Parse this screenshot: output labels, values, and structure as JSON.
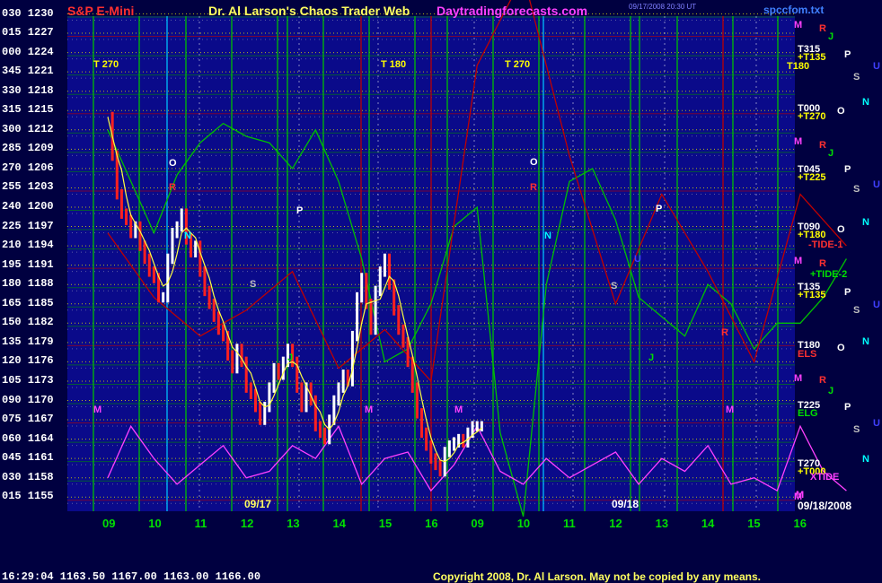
{
  "header": {
    "left_title": "S&P E-Mini",
    "center_title": "Dr. Al Larson's Chaos Trader Web",
    "site": "Daytradingforecasts.com",
    "timestamp": "09/17/2008 20:30 UT",
    "file": "spccfom.txt"
  },
  "footer": {
    "quote": "16:29:04  1163.50 1167.00 1163.00 1166.00",
    "copyright": "Copyright 2008, Dr. Al Larson. May not be copied by any means."
  },
  "colors": {
    "background": "#000040",
    "plot_bg": "#0a0a8a",
    "price_up": "#ffffff",
    "price_down": "#ff2020",
    "flux_green": "#00c000",
    "flux_red": "#c00000",
    "tide_magenta": "#ff40ff",
    "grid_yellow": "#e0e000"
  },
  "chart_data": {
    "type": "line",
    "title": "S&P E-Mini",
    "y_left_labels": [
      "030",
      "015",
      "000",
      "345",
      "330",
      "315",
      "300",
      "285",
      "270",
      "255",
      "240",
      "225",
      "210",
      "195",
      "180",
      "165",
      "150",
      "135",
      "120",
      "105",
      "090",
      "075",
      "060",
      "045",
      "030",
      "015"
    ],
    "y_right_labels": [
      "1230",
      "1227",
      "1224",
      "1221",
      "1218",
      "1215",
      "1212",
      "1209",
      "1206",
      "1203",
      "1200",
      "1197",
      "1194",
      "1191",
      "1188",
      "1185",
      "1182",
      "1179",
      "1176",
      "1173",
      "1170",
      "1167",
      "1164",
      "1161",
      "1158",
      "1155"
    ],
    "ylim": [
      1155,
      1230
    ],
    "x_tick_labels": [
      "09",
      "10",
      "11",
      "12",
      "13",
      "14",
      "15",
      "16",
      "09",
      "10",
      "11",
      "12",
      "13",
      "14",
      "15",
      "16"
    ],
    "date_labels": [
      "09/17",
      "09/18",
      "09/18/2008"
    ],
    "right_annotations": [
      {
        "text": "M",
        "color": "#ff40ff"
      },
      {
        "text": "R",
        "color": "#ff3030"
      },
      {
        "text": "J",
        "color": "#00e000"
      },
      {
        "text": "T315",
        "color": "#ffffff"
      },
      {
        "text": "+T135",
        "color": "#ffff00"
      },
      {
        "text": "T180",
        "color": "#ffff00"
      },
      {
        "text": "P",
        "color": "#ffffff"
      },
      {
        "text": "S",
        "color": "#c0c0c0"
      },
      {
        "text": "U",
        "color": "#4040ff"
      },
      {
        "text": "N",
        "color": "#00ffff"
      },
      {
        "text": "T000",
        "color": "#ffffff"
      },
      {
        "text": "+T270",
        "color": "#ffff00"
      },
      {
        "text": "O",
        "color": "#ffffff"
      },
      {
        "text": "M",
        "color": "#ff40ff"
      },
      {
        "text": "R",
        "color": "#ff3030"
      },
      {
        "text": "J",
        "color": "#00e000"
      },
      {
        "text": "T045",
        "color": "#ffffff"
      },
      {
        "text": "+T225",
        "color": "#ffff00"
      },
      {
        "text": "P",
        "color": "#ffffff"
      },
      {
        "text": "S",
        "color": "#c0c0c0"
      },
      {
        "text": "U",
        "color": "#4040ff"
      },
      {
        "text": "N",
        "color": "#00ffff"
      },
      {
        "text": "T090",
        "color": "#ffffff"
      },
      {
        "text": "+T180",
        "color": "#ffff00"
      },
      {
        "text": "O",
        "color": "#ffffff"
      },
      {
        "text": "-TIDE-1",
        "color": "#ff3030"
      },
      {
        "text": "M",
        "color": "#ff40ff"
      },
      {
        "text": "R",
        "color": "#ff3030"
      },
      {
        "text": "+TIDE-2",
        "color": "#00e000"
      },
      {
        "text": "T135",
        "color": "#ffffff"
      },
      {
        "text": "+T135",
        "color": "#ffff00"
      },
      {
        "text": "P",
        "color": "#ffffff"
      },
      {
        "text": "S",
        "color": "#c0c0c0"
      },
      {
        "text": "U",
        "color": "#4040ff"
      },
      {
        "text": "N",
        "color": "#00ffff"
      },
      {
        "text": "T180",
        "color": "#ffffff"
      },
      {
        "text": "ELS",
        "color": "#ff3030"
      },
      {
        "text": "O",
        "color": "#ffffff"
      },
      {
        "text": "M",
        "color": "#ff40ff"
      },
      {
        "text": "R",
        "color": "#ff3030"
      },
      {
        "text": "J",
        "color": "#00e000"
      },
      {
        "text": "T225",
        "color": "#ffffff"
      },
      {
        "text": "ELG",
        "color": "#00e000"
      },
      {
        "text": "P",
        "color": "#ffffff"
      },
      {
        "text": "S",
        "color": "#c0c0c0"
      },
      {
        "text": "U",
        "color": "#4040ff"
      },
      {
        "text": "N",
        "color": "#00ffff"
      },
      {
        "text": "T270",
        "color": "#ffffff"
      },
      {
        "text": "+T000",
        "color": "#ffff00"
      },
      {
        "text": "XTIDE",
        "color": "#ff40ff"
      },
      {
        "text": "M",
        "color": "#ff40ff"
      }
    ],
    "inplot_labels": [
      {
        "text": "T 270",
        "color": "#ffff00"
      },
      {
        "text": "T 180",
        "color": "#ffff00"
      },
      {
        "text": "T 270",
        "color": "#ffff00"
      },
      {
        "text": "O",
        "color": "#ffffff"
      },
      {
        "text": "R",
        "color": "#ff3030"
      },
      {
        "text": "P",
        "color": "#ffffff"
      },
      {
        "text": "N",
        "color": "#00ffff"
      },
      {
        "text": "S",
        "color": "#c0c0c0"
      },
      {
        "text": "M",
        "color": "#ff40ff"
      },
      {
        "text": "M",
        "color": "#ff40ff"
      },
      {
        "text": "M",
        "color": "#ff40ff"
      },
      {
        "text": "J",
        "color": "#00e000"
      },
      {
        "text": "O",
        "color": "#ffffff"
      },
      {
        "text": "R",
        "color": "#ff3030"
      },
      {
        "text": "N",
        "color": "#00ffff"
      },
      {
        "text": "U",
        "color": "#4040ff"
      },
      {
        "text": "S",
        "color": "#c0c0c0"
      },
      {
        "text": "P",
        "color": "#ffffff"
      },
      {
        "text": "R",
        "color": "#ff3030"
      },
      {
        "text": "J",
        "color": "#00e000"
      },
      {
        "text": "M",
        "color": "#ff40ff"
      },
      {
        "text": "M",
        "color": "#ff40ff"
      }
    ],
    "price": {
      "name": "S&P E-Mini",
      "x": [
        0,
        0.1,
        0.2,
        0.3,
        0.4,
        0.5,
        0.6,
        0.7,
        0.8,
        0.9,
        1.0,
        1.1,
        1.2,
        1.3,
        1.4,
        1.5,
        1.6,
        1.7,
        1.8,
        1.9,
        2.0,
        2.1,
        2.2,
        2.3,
        2.4,
        2.5,
        2.6,
        2.7,
        2.8,
        2.9,
        3.0,
        3.1,
        3.2,
        3.3,
        3.4,
        3.5,
        3.6,
        3.7,
        3.8,
        3.9,
        4.0,
        4.1,
        4.2,
        4.3,
        4.4,
        4.5,
        4.6,
        4.7,
        4.8,
        4.9,
        5.0,
        5.1,
        5.2,
        5.3,
        5.4,
        5.5,
        5.6,
        5.7,
        5.8,
        5.9,
        6.0,
        6.1,
        6.2,
        6.3,
        6.4,
        6.5,
        6.6,
        6.7,
        6.8,
        6.9,
        7.0,
        7.1,
        7.2,
        7.3,
        7.4,
        7.5,
        7.6,
        7.7,
        7.8,
        7.9,
        8.0,
        8.1
      ],
      "values": [
        1214,
        1208,
        1202,
        1199,
        1198,
        1196,
        1197,
        1194,
        1192,
        1190,
        1189,
        1186,
        1186,
        1192,
        1196,
        1197,
        1199,
        1195,
        1193,
        1194,
        1190,
        1187,
        1185,
        1183,
        1181,
        1180,
        1177,
        1175,
        1178,
        1176,
        1172,
        1171,
        1169,
        1167,
        1169,
        1172,
        1175,
        1174,
        1176,
        1178,
        1176,
        1172,
        1169,
        1172,
        1170,
        1166,
        1165,
        1164,
        1167,
        1170,
        1172,
        1174,
        1173,
        1180,
        1186,
        1189,
        1185,
        1181,
        1187,
        1190,
        1192,
        1188,
        1184,
        1181,
        1179,
        1176,
        1172,
        1168,
        1165,
        1163,
        1161,
        1160,
        1159,
        1162,
        1163,
        1163.5,
        1164,
        1163.5,
        1165,
        1166,
        1166,
        1166
      ]
    },
    "series": [
      {
        "name": "+TIDE-2",
        "color": "#00c000",
        "x": [
          0,
          1,
          1.5,
          2,
          2.5,
          3,
          3.5,
          4,
          4.5,
          5,
          5.5,
          6,
          6.5,
          7,
          7.5,
          8,
          8.5,
          9,
          9.5,
          10,
          10.5,
          11,
          11.5,
          12,
          12.5,
          13,
          13.5,
          14,
          14.5,
          15,
          15.5,
          16
        ],
        "values": [
          1212,
          1196,
          1205,
          1210,
          1213,
          1211,
          1210,
          1206,
          1212,
          1204,
          1192,
          1176,
          1178,
          1185,
          1197,
          1200,
          1165,
          1152,
          1188,
          1204,
          1206,
          1198,
          1186,
          1183,
          1180,
          1188,
          1185,
          1178,
          1182,
          1182,
          1186,
          1192
        ]
      },
      {
        "name": "-TIDE-1",
        "color": "#c00000",
        "x": [
          0,
          1,
          2,
          3,
          4,
          5,
          6,
          7,
          8,
          9,
          10,
          11,
          12,
          13,
          14,
          15,
          16
        ],
        "values": [
          1196,
          1186,
          1180,
          1184,
          1190,
          1175,
          1181,
          1173,
          1222,
          1236,
          1208,
          1185,
          1202,
          1190,
          1176,
          1202,
          1194
        ]
      },
      {
        "name": "XTIDE",
        "color": "#ff40ff",
        "x": [
          0,
          0.5,
          1,
          1.5,
          2,
          2.5,
          3,
          3.5,
          4,
          4.5,
          5,
          5.5,
          6,
          6.5,
          7,
          7.5,
          8,
          8.5,
          9,
          9.5,
          10,
          10.5,
          11,
          11.5,
          12,
          12.5,
          13,
          13.5,
          14,
          14.5,
          15,
          15.5,
          16
        ],
        "values": [
          1158,
          1166,
          1161,
          1157,
          1160,
          1163,
          1158,
          1159,
          1163,
          1161,
          1166,
          1157,
          1161,
          1162,
          1156,
          1160,
          1166,
          1159,
          1157,
          1161,
          1158,
          1160,
          1162,
          1157,
          1161,
          1159,
          1163,
          1157,
          1158,
          1156,
          1166,
          1159,
          1156
        ]
      }
    ]
  }
}
